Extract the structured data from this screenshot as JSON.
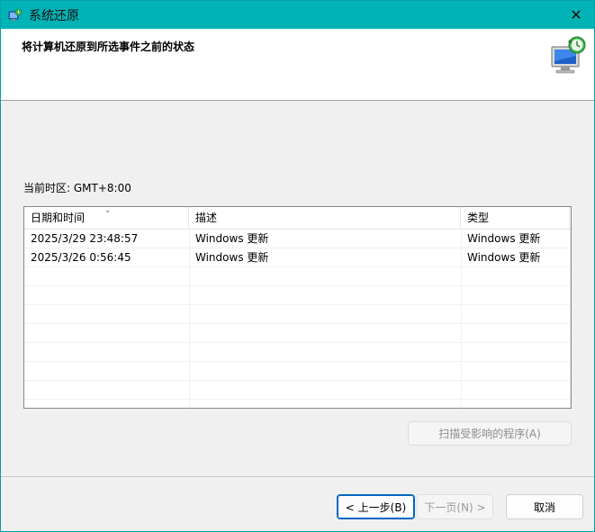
{
  "window": {
    "title": "系统还原",
    "close_glyph": "✕",
    "app_icon": "system-restore-icon"
  },
  "header": {
    "heading": "将计算机还原到所选事件之前的状态",
    "icon": "restore-computer-icon"
  },
  "timezone_label": "当前时区: GMT+8:00",
  "table": {
    "columns": [
      "日期和时间",
      "描述",
      "类型"
    ],
    "sort_indicator": "⌄",
    "rows": [
      {
        "datetime": "2025/3/29 23:48:57",
        "description": "Windows 更新",
        "type": "Windows 更新"
      },
      {
        "datetime": "2025/3/26 0:56:45",
        "description": "Windows 更新",
        "type": "Windows 更新"
      }
    ]
  },
  "buttons": {
    "scan": "扫描受影响的程序(A)",
    "back": "< 上一步(B)",
    "next": "下一页(N) >",
    "cancel": "取消"
  },
  "colors": {
    "titlebar": "#00b3b6",
    "accent": "#0067c0"
  }
}
